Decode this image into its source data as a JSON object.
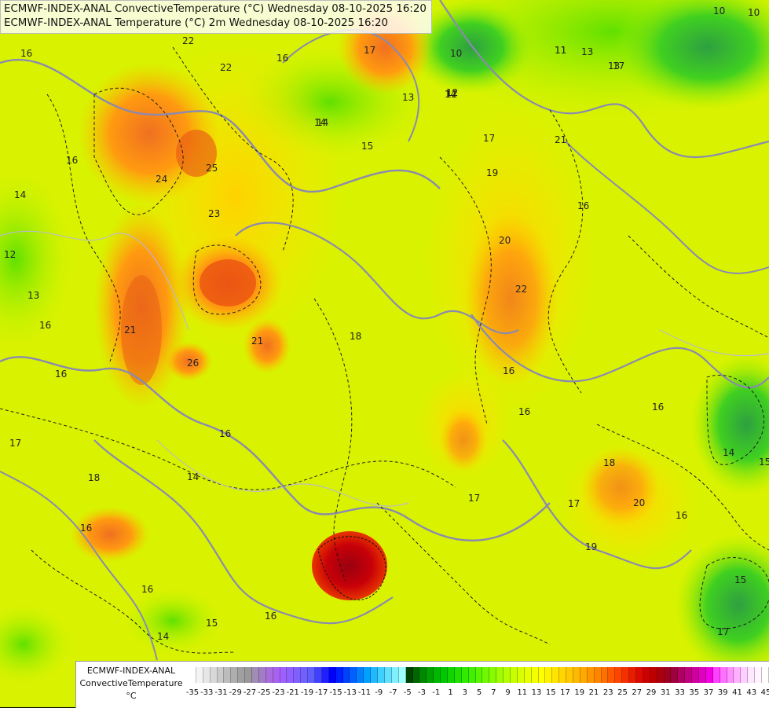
{
  "header": {
    "line1": "ECMWF-INDEX-ANAL ConvectiveTemperature (°C) Wednesday 08-10-2025 16:20",
    "line2": "ECMWF-INDEX-ANAL Temperature (°C) 2m Wednesday 08-10-2025 16:20"
  },
  "legend": {
    "model": "ECMWF-INDEX-ANAL",
    "variable": "ConvectiveTemperature",
    "unit": "°C",
    "ticks": [
      "-35",
      "-33",
      "-31",
      "-29",
      "-27",
      "-25",
      "-23",
      "-21",
      "-19",
      "-17",
      "-15",
      "-13",
      "-11",
      "-9",
      "-7",
      "-5",
      "-3",
      "-1",
      "1",
      "3",
      "5",
      "7",
      "9",
      "11",
      "13",
      "15",
      "17",
      "19",
      "21",
      "23",
      "25",
      "27",
      "29",
      "31",
      "33",
      "35",
      "37",
      "39",
      "41",
      "43",
      "45"
    ],
    "colors": [
      "#ffffff",
      "#f4f4f4",
      "#e6e6e6",
      "#d8d8d8",
      "#cacaca",
      "#bcbcbc",
      "#aeaeae",
      "#a0a0a0",
      "#999999",
      "#a08cb4",
      "#a37cc8",
      "#a86cdc",
      "#a861f0",
      "#9f60ff",
      "#8f60ff",
      "#7f60ff",
      "#6f60ff",
      "#5f5fff",
      "#4040ff",
      "#2020ff",
      "#0000ff",
      "#0020ff",
      "#0040ff",
      "#0060ff",
      "#0080ff",
      "#00a0ff",
      "#20b8ff",
      "#40d0ff",
      "#60e0ff",
      "#80f0ff",
      "#a0ffff",
      "#004400",
      "#006600",
      "#008800",
      "#00a000",
      "#00b800",
      "#00c800",
      "#10d400",
      "#20e000",
      "#30ea00",
      "#40f000",
      "#58f400",
      "#70f800",
      "#88fa00",
      "#a0fc00",
      "#b4fe00",
      "#c8ff00",
      "#d8ff00",
      "#e8ff00",
      "#f4ff00",
      "#ffff00",
      "#fff200",
      "#ffe400",
      "#ffd600",
      "#ffc800",
      "#ffb800",
      "#ffa800",
      "#ff9600",
      "#ff8400",
      "#ff7000",
      "#ff5a00",
      "#ff4400",
      "#f43000",
      "#e81c00",
      "#dc0a00",
      "#cc0000",
      "#bc0000",
      "#ac0010",
      "#a00020",
      "#a00040",
      "#b00060",
      "#c00080",
      "#d000a0",
      "#e000c0",
      "#f000e0",
      "#ff40ff",
      "#ff70ff",
      "#ff90ff",
      "#ffb0ff",
      "#ffd0ff",
      "#ffe8ff",
      "#fff4ff",
      "#ffffff"
    ]
  },
  "map": {
    "contour_labels": [
      "16",
      "22",
      "22",
      "16",
      "17",
      "10",
      "13",
      "14",
      "12",
      "13",
      "11",
      "14",
      "16",
      "15",
      "17",
      "16",
      "14",
      "19",
      "21",
      "25",
      "24",
      "23",
      "16",
      "16",
      "21",
      "12",
      "13",
      "20",
      "22",
      "17",
      "18",
      "18",
      "21",
      "26",
      "16",
      "16",
      "17",
      "16",
      "18",
      "16",
      "19",
      "20",
      "14",
      "17",
      "14",
      "16",
      "15",
      "16",
      "16",
      "14",
      "15",
      "15",
      "17",
      "17",
      "10",
      "10",
      "13",
      "12",
      "16",
      "11",
      "14"
    ]
  }
}
